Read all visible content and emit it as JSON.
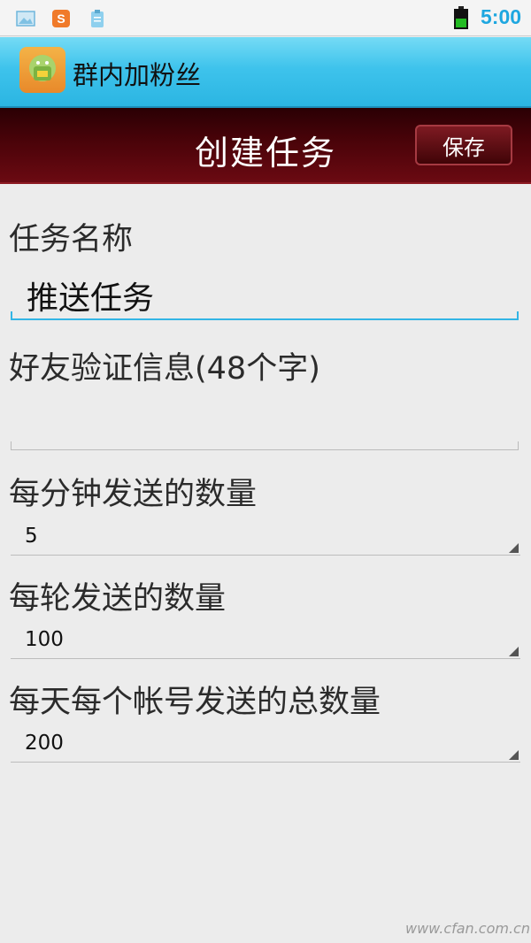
{
  "status_bar": {
    "time": "5:00",
    "icons": [
      "gallery-icon",
      "sogou-input-icon",
      "clipboard-icon",
      "battery-icon"
    ],
    "battery_color": "#22bb22"
  },
  "app_bar": {
    "title": "群内加粉丝",
    "logo_icon": "android-app-icon"
  },
  "task_bar": {
    "title": "创建任务",
    "save_label": "保存"
  },
  "form": {
    "task_name": {
      "label": "任务名称",
      "value": "推送任务"
    },
    "verify_message": {
      "label": "好友验证信息(48个字)",
      "value": ""
    },
    "per_minute": {
      "label": "每分钟发送的数量",
      "value": "5"
    },
    "per_round": {
      "label": "每轮发送的数量",
      "value": "100"
    },
    "per_account_daily": {
      "label": "每天每个帐号发送的总数量",
      "value": "200"
    }
  },
  "watermark": "www.cfan.com.cn",
  "colors": {
    "accent": "#33b5e5",
    "app_bar": "#3ec3ec",
    "task_bar": "#4a0309"
  }
}
